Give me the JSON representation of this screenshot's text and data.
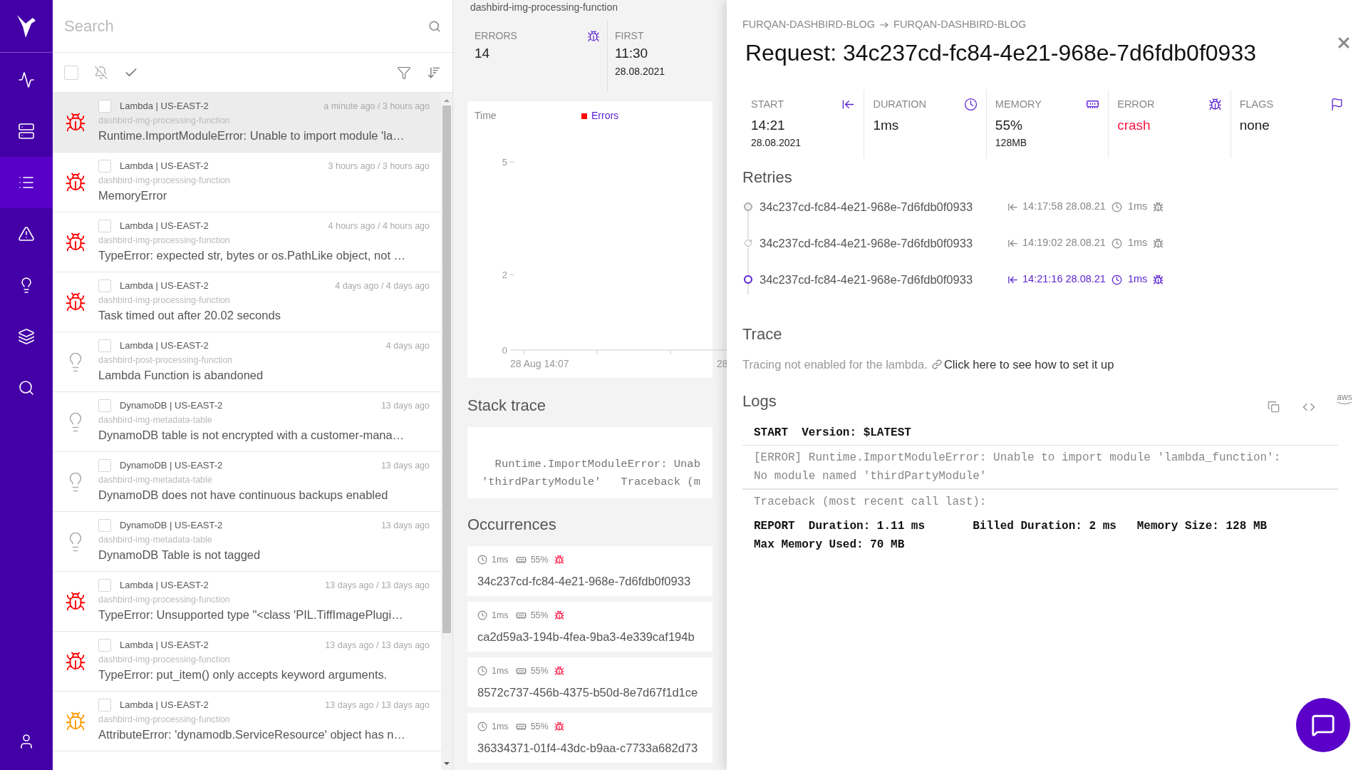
{
  "sidebar": {
    "items": [
      {
        "kind": "pulse",
        "selected": false
      },
      {
        "kind": "server",
        "selected": false
      },
      {
        "kind": "list",
        "selected": true
      },
      {
        "kind": "alert",
        "selected": false
      },
      {
        "kind": "bulb",
        "selected": false
      },
      {
        "kind": "layers",
        "selected": false
      },
      {
        "kind": "search",
        "selected": false
      },
      {
        "kind": "user",
        "selected": false
      }
    ]
  },
  "issues": {
    "search": {
      "placeholder": "Search"
    },
    "select_all": {
      "checked": false
    },
    "rows": [
      {
        "kind": "bug",
        "color": "#ff0000",
        "selected": true,
        "checked": false,
        "service": "Lambda | US-EAST-2",
        "time": "a minute ago / 3 hours ago",
        "resource": "dashbird-img-processing-function",
        "message": "Runtime.ImportModuleError: Unable to import module 'la…"
      },
      {
        "kind": "bug",
        "color": "#ff0000",
        "selected": false,
        "checked": false,
        "service": "Lambda | US-EAST-2",
        "time": "3 hours ago / 3 hours ago",
        "resource": "dashbird-img-processing-function",
        "message": "MemoryError"
      },
      {
        "kind": "bug",
        "color": "#ff0000",
        "selected": false,
        "checked": false,
        "service": "Lambda | US-EAST-2",
        "time": "4 hours ago / 4 hours ago",
        "resource": "dashbird-img-processing-function",
        "message": "TypeError: expected str, bytes or os.PathLike object, not …"
      },
      {
        "kind": "bug",
        "color": "#ff0000",
        "selected": false,
        "checked": false,
        "service": "Lambda | US-EAST-2",
        "time": "4 days ago / 4 days ago",
        "resource": "dashbird-img-processing-function",
        "message": "Task timed out after 20.02 seconds"
      },
      {
        "kind": "bulb",
        "color": "#b0b0b0",
        "selected": false,
        "checked": false,
        "service": "Lambda | US-EAST-2",
        "time": "4 days ago",
        "resource": "dashbird-post-processing-function",
        "message": "Lambda Function is abandoned"
      },
      {
        "kind": "bulb",
        "color": "#b0b0b0",
        "selected": false,
        "checked": false,
        "service": "DynamoDB | US-EAST-2",
        "time": "13 days ago",
        "resource": "dashbird-img-metadata-table",
        "message": "DynamoDB table is not encrypted with a customer-mana…"
      },
      {
        "kind": "bulb",
        "color": "#b0b0b0",
        "selected": false,
        "checked": false,
        "service": "DynamoDB | US-EAST-2",
        "time": "13 days ago",
        "resource": "dashbird-img-metadata-table",
        "message": "DynamoDB does not have continuous backups enabled"
      },
      {
        "kind": "bulb",
        "color": "#b0b0b0",
        "selected": false,
        "checked": false,
        "service": "DynamoDB | US-EAST-2",
        "time": "13 days ago",
        "resource": "dashbird-img-metadata-table",
        "message": "DynamoDB Table is not tagged"
      },
      {
        "kind": "bug",
        "color": "#ff0000",
        "selected": false,
        "checked": false,
        "service": "Lambda | US-EAST-2",
        "time": "13 days ago / 13 days ago",
        "resource": "dashbird-img-processing-function",
        "message": "TypeError: Unsupported type \"<class 'PIL.TiffImagePlugi…"
      },
      {
        "kind": "bug",
        "color": "#ff0000",
        "selected": false,
        "checked": false,
        "service": "Lambda | US-EAST-2",
        "time": "13 days ago / 13 days ago",
        "resource": "dashbird-img-processing-function",
        "message": "TypeError: put_item() only accepts keyword arguments."
      },
      {
        "kind": "bug",
        "color": "#ff9900",
        "selected": false,
        "checked": false,
        "service": "Lambda | US-EAST-2",
        "time": "13 days ago / 13 days ago",
        "resource": "dashbird-img-processing-function",
        "message": "AttributeError: 'dynamodb.ServiceResource' object has n…"
      }
    ]
  },
  "issue": {
    "resource": "dashbird-img-processing-function",
    "stats": [
      {
        "label": "ERRORS",
        "value": "14"
      },
      {
        "label": "FIRST",
        "value": "11:30",
        "sub": "28.08.2021"
      }
    ],
    "chart_data": {
      "type": "bar",
      "xlabel": "Time",
      "ylim": [
        0,
        5
      ],
      "yticks": [
        0,
        2,
        5
      ],
      "categories": [
        "28 Aug 14:07",
        "28"
      ],
      "series": [
        {
          "name": "Errors",
          "color": "#ff0000",
          "values": [
            0,
            0
          ]
        }
      ]
    },
    "stack_trace": {
      "title": "Stack trace",
      "lines": [
        "  Runtime.ImportModuleError: Unab",
        "'thirdPartyModule'   Traceback (m"
      ]
    },
    "occurrences": {
      "title": "Occurrences",
      "items": [
        {
          "duration": "1ms",
          "memory": "55%",
          "id": "34c237cd-fc84-4e21-968e-7d6fdb0f0933"
        },
        {
          "duration": "1ms",
          "memory": "55%",
          "id": "ca2d59a3-194b-4fea-9ba3-4e339caf194b"
        },
        {
          "duration": "1ms",
          "memory": "55%",
          "id": "8572c737-456b-4375-b50d-8e7d67f1d1ce"
        },
        {
          "duration": "1ms",
          "memory": "55%",
          "id": "36334371-01f4-43dc-b9aa-c7733a682d73"
        }
      ]
    }
  },
  "request": {
    "breadcrumb": [
      "FURQAN-DASHBIRD-BLOG",
      "FURQAN-DASHBIRD-BLOG"
    ],
    "title": "Request: 34c237cd-fc84-4e21-968e-7d6fdb0f0933",
    "stats": [
      {
        "kind": "start",
        "label": "START",
        "value": "14:21",
        "sub": "28.08.2021"
      },
      {
        "kind": "duration",
        "label": "DURATION",
        "value": "1ms"
      },
      {
        "kind": "memory",
        "label": "MEMORY",
        "value": "55%",
        "sub": "128MB"
      },
      {
        "kind": "error",
        "label": "ERROR",
        "value": "crash",
        "color": "#ff1744"
      },
      {
        "kind": "flags",
        "label": "FLAGS",
        "value": "none",
        "color": "#222222"
      }
    ],
    "retries": {
      "title": "Retries",
      "items": [
        {
          "kind": "first",
          "selected": false,
          "id": "34c237cd-fc84-4e21-968e-7d6fdb0f0933",
          "start": "14:17:58 28.08.21",
          "duration": "1ms"
        },
        {
          "kind": "retry",
          "selected": false,
          "id": "34c237cd-fc84-4e21-968e-7d6fdb0f0933",
          "start": "14:19:02 28.08.21",
          "duration": "1ms"
        },
        {
          "kind": "first",
          "selected": true,
          "id": "34c237cd-fc84-4e21-968e-7d6fdb0f0933",
          "start": "14:21:16 28.08.21",
          "duration": "1ms"
        }
      ]
    },
    "trace": {
      "title": "Trace",
      "text": "Tracing not enabled for the lambda.",
      "link": "Click here to see how to set it up"
    },
    "logs": {
      "title": "Logs",
      "aws_label": "aws",
      "entries": [
        {
          "kind": "meta",
          "lines": [
            "START  Version: $LATEST"
          ]
        },
        {
          "kind": "output",
          "lines": [
            "[ERROR] Runtime.ImportModuleError: Unable to import module 'lambda_function':",
            "No module named 'thirdPartyModule'"
          ]
        },
        {
          "kind": "output",
          "lines": [
            "Traceback (most recent call last):"
          ]
        },
        {
          "kind": "meta",
          "lines": [
            "REPORT  Duration: 1.11 ms       Billed Duration: 2 ms   Memory Size: 128 MB",
            "Max Memory Used: 70 MB"
          ]
        }
      ]
    }
  }
}
